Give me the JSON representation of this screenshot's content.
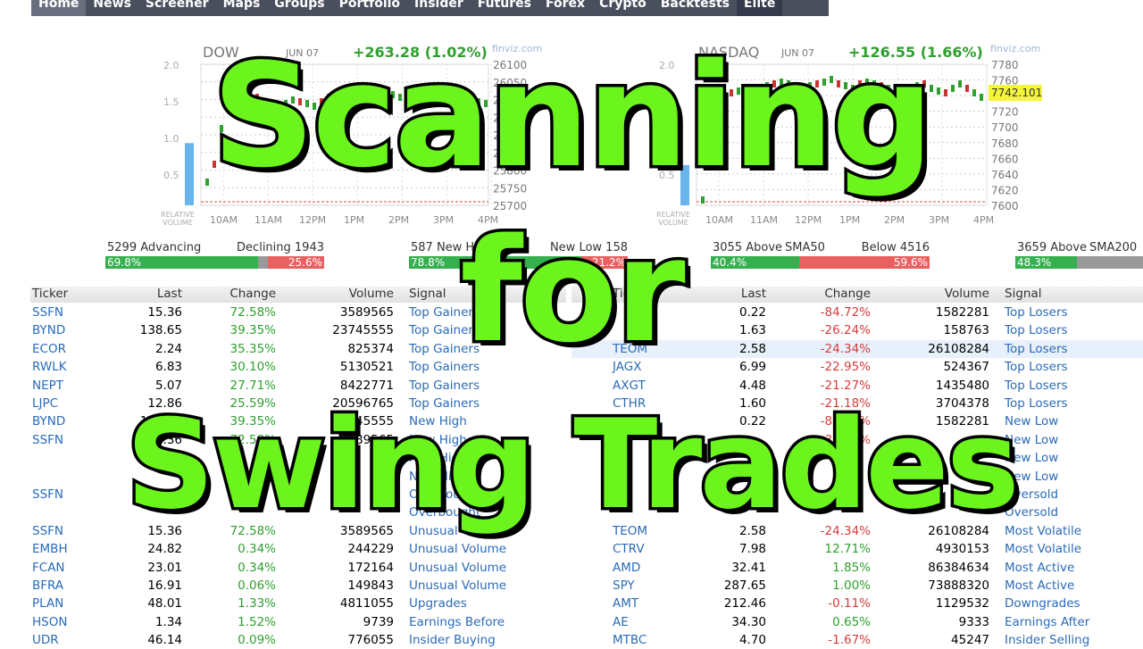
{
  "nav": {
    "items": [
      "Home",
      "News",
      "Screener",
      "Maps",
      "Groups",
      "Portfolio",
      "Insider",
      "Futures",
      "Forex",
      "Crypto",
      "Backtests",
      "Elite"
    ],
    "active": "Home"
  },
  "charts": [
    {
      "name": "DOW",
      "date": "JUN 07",
      "change": "+263.28 (1.02%)",
      "watermark": "finviz.com",
      "rel_axis": [
        "2.0",
        "1.5",
        "1.0",
        "0.5"
      ],
      "rel_label": "RELATIVE VOLUME",
      "price_axis": [
        "26100",
        "26050",
        "26000",
        "25950",
        "25900",
        "25850",
        "25800",
        "25750",
        "25700"
      ],
      "time_axis": [
        "10AM",
        "11AM",
        "12PM",
        "1PM",
        "2PM",
        "3PM",
        "4PM"
      ],
      "rel_volume": 0.85
    },
    {
      "name": "NASDAQ",
      "date": "JUN 07",
      "change": "+126.55 (1.66%)",
      "watermark": "finviz.com",
      "rel_axis": [
        "2.0",
        "1.5",
        "1.0",
        "0.5"
      ],
      "rel_label": "RELATIVE VOLUME",
      "price_axis": [
        "7780",
        "7760",
        "7740",
        "7720",
        "7700",
        "7680",
        "7660",
        "7640",
        "7620",
        "7600"
      ],
      "time_axis": [
        "10AM",
        "11AM",
        "12PM",
        "1PM",
        "2PM",
        "3PM",
        "4PM"
      ],
      "last_price": "7742.101",
      "rel_volume": 0.55
    }
  ],
  "breadth": [
    {
      "left": "5299 Advancing",
      "right": "Declining 1943",
      "left_pct": "69.8%",
      "right_pct": "25.6%",
      "left_val": 69.8,
      "right_val": 25.6
    },
    {
      "left": "587 New High",
      "right": "New Low 158",
      "left_pct": "78.8%",
      "right_pct": "21.2%",
      "left_val": 78.8,
      "right_val": 21.2
    },
    {
      "left": "3055 Above",
      "mid": "SMA50",
      "right": "Below 4516",
      "left_pct": "40.4%",
      "right_pct": "59.6%",
      "left_val": 40.4,
      "right_val": 59.6
    },
    {
      "left": "3659 Above",
      "mid": "SMA200",
      "left_pct": "48.3%",
      "left_val": 48.3
    }
  ],
  "colors": {
    "positive": "#2ea02e",
    "negative": "#d63c3c",
    "link": "#2a6bb8",
    "overlay_text": "#6cf51c"
  },
  "table": {
    "headers": [
      "Ticker",
      "Last",
      "Change",
      "Volume",
      "Signal"
    ],
    "left": [
      [
        "SSFN",
        "15.36",
        "72.58%",
        "3589565",
        "Top Gainers"
      ],
      [
        "BYND",
        "138.65",
        "39.35%",
        "23745555",
        "Top Gainers"
      ],
      [
        "ECOR",
        "2.24",
        "35.35%",
        "825374",
        "Top Gainers"
      ],
      [
        "RWLK",
        "6.83",
        "30.10%",
        "5130521",
        "Top Gainers"
      ],
      [
        "NEPT",
        "5.07",
        "27.71%",
        "8422771",
        "Top Gainers"
      ],
      [
        "LJPC",
        "12.86",
        "25.59%",
        "20596765",
        "Top Gainers"
      ],
      [
        "BYND",
        "138.65",
        "39.35%",
        "23745555",
        "New High"
      ],
      [
        "SSFN",
        "15.36",
        "72.58%",
        "3589565",
        "New High"
      ],
      [
        "",
        "",
        "",
        "",
        "New High"
      ],
      [
        "",
        "",
        "",
        "",
        "New High"
      ],
      [
        "SSFN",
        "",
        "",
        "",
        "Overbought"
      ],
      [
        "",
        "",
        "",
        "",
        "Overbought"
      ],
      [
        "SSFN",
        "15.36",
        "72.58%",
        "3589565",
        "Unusual Volume"
      ],
      [
        "EMBH",
        "24.82",
        "0.34%",
        "244229",
        "Unusual Volume"
      ],
      [
        "FCAN",
        "23.01",
        "0.34%",
        "172164",
        "Unusual Volume"
      ],
      [
        "BFRA",
        "16.91",
        "0.06%",
        "149843",
        "Unusual Volume"
      ],
      [
        "PLAN",
        "48.01",
        "1.33%",
        "4811055",
        "Upgrades"
      ],
      [
        "HSON",
        "1.34",
        "1.52%",
        "9739",
        "Earnings Before"
      ],
      [
        "UDR",
        "46.14",
        "0.09%",
        "776055",
        "Insider Buying"
      ]
    ],
    "right": [
      [
        "",
        "0.22",
        "-84.72%",
        "1582281",
        "Top Losers"
      ],
      [
        "",
        "1.63",
        "-26.24%",
        "158763",
        "Top Losers"
      ],
      [
        "TEOM",
        "2.58",
        "-24.34%",
        "26108284",
        "Top Losers"
      ],
      [
        "JAGX",
        "6.99",
        "-22.95%",
        "524367",
        "Top Losers"
      ],
      [
        "AXGT",
        "4.48",
        "-21.27%",
        "1435480",
        "Top Losers"
      ],
      [
        "CTHR",
        "1.60",
        "-21.18%",
        "3704378",
        "Top Losers"
      ],
      [
        "",
        "0.22",
        "-84.72%",
        "1582281",
        "New Low"
      ],
      [
        "",
        "",
        "-38.36%",
        "",
        "New Low"
      ],
      [
        "",
        "",
        "",
        "",
        "New Low"
      ],
      [
        "",
        "",
        "",
        "",
        "New Low"
      ],
      [
        "",
        "",
        "",
        "",
        "Oversold"
      ],
      [
        "",
        "",
        "",
        "",
        "Oversold"
      ],
      [
        "TEOM",
        "2.58",
        "-24.34%",
        "26108284",
        "Most Volatile"
      ],
      [
        "CTRV",
        "7.98",
        "12.71%",
        "4930153",
        "Most Volatile"
      ],
      [
        "AMD",
        "32.41",
        "1.85%",
        "86384634",
        "Most Active"
      ],
      [
        "SPY",
        "287.65",
        "1.00%",
        "73888320",
        "Most Active"
      ],
      [
        "AMT",
        "212.46",
        "-0.11%",
        "1129532",
        "Downgrades"
      ],
      [
        "AE",
        "34.30",
        "0.65%",
        "9333",
        "Earnings After"
      ],
      [
        "MTBC",
        "4.70",
        "-1.67%",
        "45247",
        "Insider Selling"
      ]
    ]
  },
  "overlay": {
    "line1": "Scanning",
    "line2": "for",
    "line3": "Swing Trades"
  }
}
